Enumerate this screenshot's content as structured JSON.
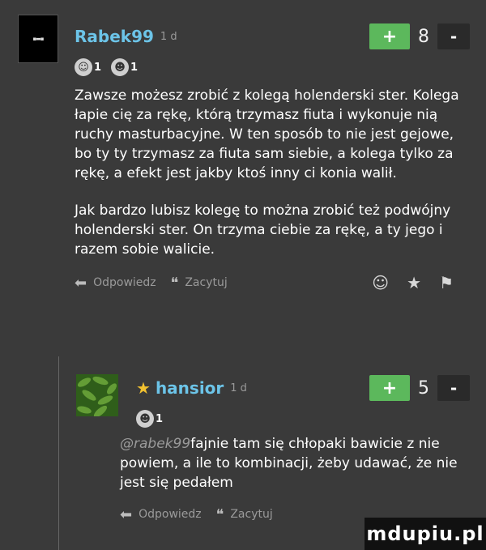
{
  "comment1": {
    "username": "Rabek99",
    "time": "1 d",
    "plus_label": "+",
    "score": "8",
    "minus_label": "-",
    "reactions": [
      {
        "count": "1"
      },
      {
        "count": "1"
      }
    ],
    "paragraph1": "Zawsze możesz zrobić z kolegą holenderski ster. Kolega łapie cię za rękę, którą trzymasz fiuta i wykonuje nią ruchy masturbacyjne. W ten sposób to nie jest gejowe, bo ty ty trzymasz za fiuta sam siebie, a kolega tylko za rękę, a efekt jest jakby ktoś inny ci konia walił.",
    "paragraph2": "Jak bardzo lubisz kolegę to można zrobić też podwójny holenderski ster. On trzyma ciebie za rękę, a ty jego i razem sobie walicie.",
    "reply_label": "Odpowiedz",
    "quote_label": "Zacytuj"
  },
  "comment2": {
    "username": "hansior",
    "time": "1 d",
    "plus_label": "+",
    "score": "5",
    "minus_label": "-",
    "reactions": [
      {
        "count": "1"
      }
    ],
    "mention": "@rabek99",
    "text": "fajnie tam się chłopaki bawicie z nie powiem, a ile to kombinacji, żeby udawać, że nie jest się pedałem",
    "reply_label": "Odpowiedz",
    "quote_label": "Zacytuj"
  },
  "watermark": "mdupiu.pl"
}
